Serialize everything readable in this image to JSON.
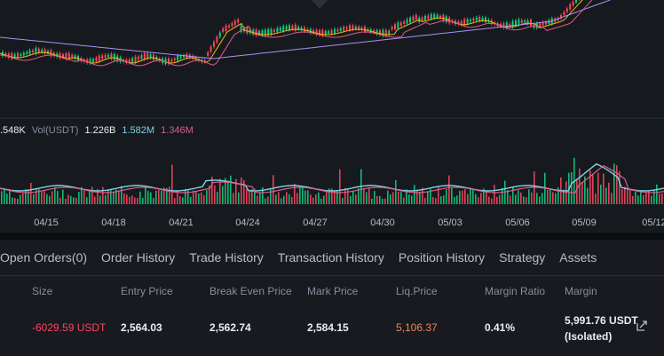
{
  "chart": {
    "vol_legend": {
      "vol_base": ".548K",
      "vol_quote_label": "Vol(USDT)",
      "vol_quote": "1.226B",
      "ma1": "1.582M",
      "ma2": "1.346M"
    },
    "x_ticks": [
      "04/15",
      "04/18",
      "04/21",
      "04/24",
      "04/27",
      "04/30",
      "05/03",
      "05/06",
      "05/09",
      "05/12"
    ],
    "colors": {
      "up": "#0ecb81",
      "down": "#f6465d",
      "ma_yellow": "#f0b90b",
      "ma_pink": "#e05b8a",
      "ma_purple": "#b28df7",
      "vol_ma_blue": "#7fd3e8"
    }
  },
  "tabs": [
    {
      "label": "Open Orders(0)"
    },
    {
      "label": "Order History"
    },
    {
      "label": "Trade History"
    },
    {
      "label": "Transaction History"
    },
    {
      "label": "Position History"
    },
    {
      "label": "Strategy"
    },
    {
      "label": "Assets"
    }
  ],
  "positions": {
    "headers": {
      "size": "Size",
      "entry_price": "Entry Price",
      "break_even": "Break Even Price",
      "mark_price": "Mark Price",
      "liq_price": "Liq.Price",
      "margin_ratio": "Margin Ratio",
      "margin": "Margin"
    },
    "row": {
      "size": "-6029.59 USDT",
      "entry_price": "2,564.03",
      "break_even": "2,562.74",
      "mark_price": "2,584.15",
      "liq_price": "5,106.37",
      "margin_ratio": "0.41%",
      "margin": "5,991.76 USDT",
      "margin_mode": "(Isolated)"
    }
  }
}
